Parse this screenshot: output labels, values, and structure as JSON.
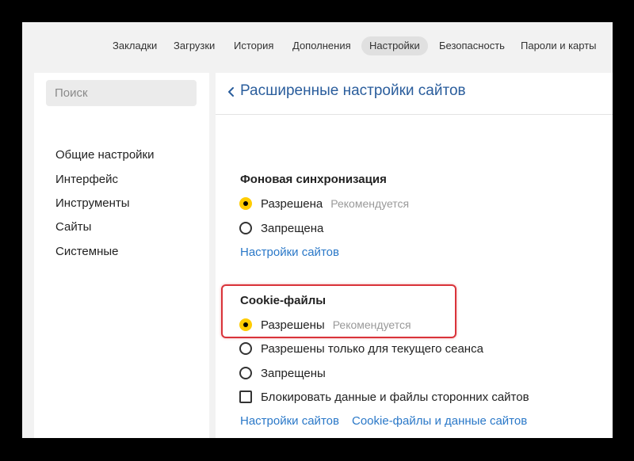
{
  "topnav": {
    "tabs": [
      {
        "label": "Закладки"
      },
      {
        "label": "Загрузки"
      },
      {
        "label": "История"
      },
      {
        "label": "Дополнения"
      },
      {
        "label": "Настройки",
        "active": true
      },
      {
        "label": "Безопасность"
      },
      {
        "label": "Пароли и карты"
      }
    ]
  },
  "sidebar": {
    "search_placeholder": "Поиск",
    "items": [
      {
        "label": "Общие настройки"
      },
      {
        "label": "Интерфейс"
      },
      {
        "label": "Инструменты"
      },
      {
        "label": "Сайты"
      },
      {
        "label": "Системные"
      }
    ]
  },
  "content": {
    "back_icon": "chevron-left-icon",
    "title": "Расширенные настройки сайтов",
    "background_sync": {
      "title": "Фоновая синхронизация",
      "options": [
        {
          "label": "Разрешена",
          "hint": "Рекомендуется",
          "checked": true
        },
        {
          "label": "Запрещена",
          "checked": false
        }
      ],
      "link": "Настройки сайтов"
    },
    "cookies": {
      "title": "Cookie-файлы",
      "options": [
        {
          "label": "Разрешены",
          "hint": "Рекомендуется",
          "checked": true
        },
        {
          "label": "Разрешены только для текущего сеанса",
          "checked": false
        },
        {
          "label": "Запрещены",
          "checked": false
        }
      ],
      "checkbox": {
        "label": "Блокировать данные и файлы сторонних сайтов",
        "checked": false
      },
      "links": [
        "Настройки сайтов",
        "Cookie-файлы и данные сайтов"
      ]
    }
  },
  "colors": {
    "accent_link": "#2a78c8",
    "title_blue": "#2a5d9c",
    "radio_selected": "#ffcc00",
    "highlight_red": "#d9333a"
  }
}
